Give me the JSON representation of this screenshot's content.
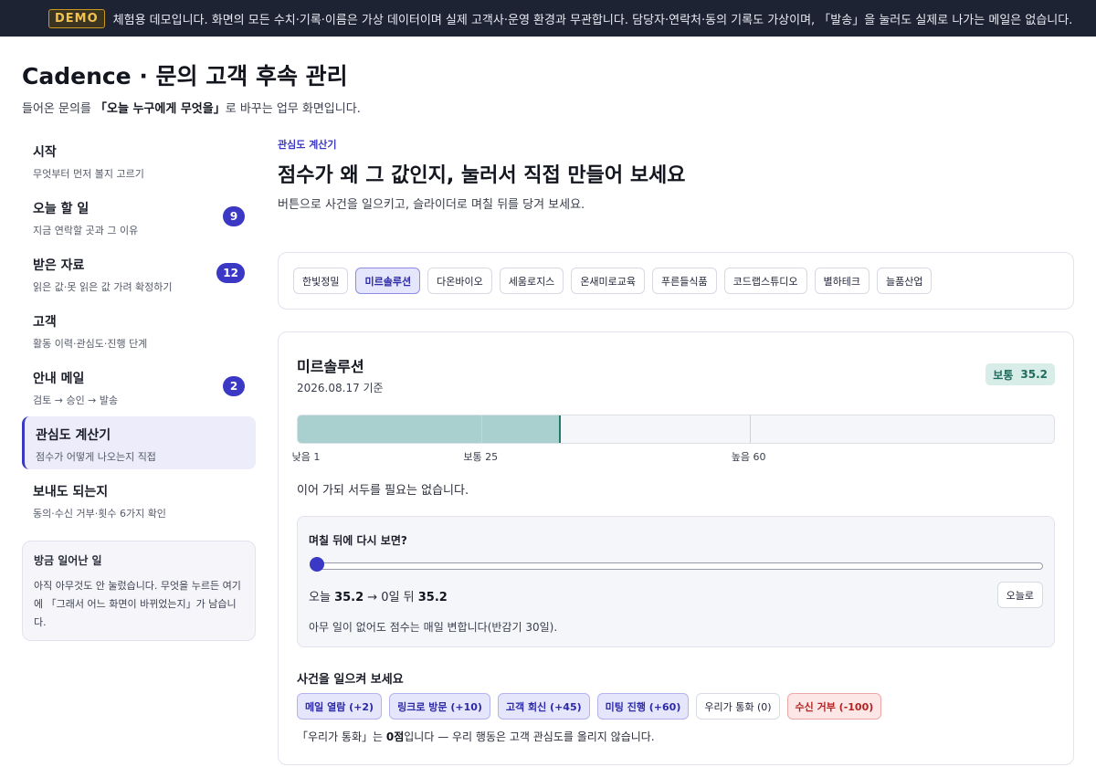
{
  "banner": {
    "badge": "DEMO",
    "text": "체험용 데모입니다. 화면의 모든 수치·기록·이름은 가상 데이터이며 실제 고객사·운영 환경과 무관합니다. 담당자·연락처·동의 기록도 가상이며, 「발송」을 눌러도 실제로 나가는 메일은 없습니다."
  },
  "header": {
    "title": "Cadence · 문의 고객 후속 관리",
    "subtitle_pre": "들어온 문의를 ",
    "subtitle_bold": "「오늘 누구에게 무엇을」",
    "subtitle_post": "로 바꾸는 업무 화면입니다."
  },
  "sidebar": {
    "items": [
      {
        "label": "시작",
        "desc": "무엇부터 먼저 볼지 고르기",
        "badge": ""
      },
      {
        "label": "오늘 할 일",
        "desc": "지금 연락할 곳과 그 이유",
        "badge": "9"
      },
      {
        "label": "받은 자료",
        "desc": "읽은 값·못 읽은 값 가려 확정하기",
        "badge": "12"
      },
      {
        "label": "고객",
        "desc": "활동 이력·관심도·진행 단계",
        "badge": ""
      },
      {
        "label": "안내 메일",
        "desc": "검토 → 승인 → 발송",
        "badge": "2"
      },
      {
        "label": "관심도 계산기",
        "desc": "점수가 어떻게 나오는지 직접",
        "badge": ""
      },
      {
        "label": "보내도 되는지",
        "desc": "동의·수신 거부·횟수 6가지 확인",
        "badge": ""
      }
    ],
    "recent": {
      "title": "방금 일어난 일",
      "body": "아직 아무것도 안 눌렀습니다. 무엇을 누르든 여기에 「그래서 어느 화면이 바뀌었는지」가 남습니다."
    }
  },
  "main": {
    "eyebrow": "관심도 계산기",
    "title": "점수가 왜 그 값인지, 눌러서 직접 만들어 보세요",
    "subtitle": "버튼으로 사건을 일으키고, 슬라이더로 며칠 뒤를 당겨 보세요.",
    "companies": [
      "한빛정밀",
      "미르솔루션",
      "다온바이오",
      "세움로지스",
      "온새미로교육",
      "푸른들식품",
      "코드랩스튜디오",
      "별하테크",
      "늘품산업"
    ],
    "selected_company": "미르솔루션",
    "detail": {
      "name": "미르솔루션",
      "date": "2026.08.17 기준",
      "level_label": "보통",
      "score": "35.2",
      "gauge": {
        "min": 1,
        "max": 100,
        "value": 35.2,
        "thresholds": [
          {
            "label": "낮음 1",
            "value": 1
          },
          {
            "label": "보통 25",
            "value": 25
          },
          {
            "label": "높음 60",
            "value": 60
          }
        ]
      },
      "message": "이어 가되 서두를 필요는 없습니다.",
      "forecast": {
        "title": "며칠 뒤에 다시 보면?",
        "days": 0,
        "days_max": 90,
        "today_label": "오늘 ",
        "today_score": "35.2",
        "arrow_text": " → 0일 뒤 ",
        "future_score": "35.2",
        "reset_label": "오늘로",
        "note": "아무 일이 없어도 점수는 매일 변합니다(반감기 30일)."
      },
      "events": {
        "title": "사건을 일으켜 보세요",
        "buttons": [
          {
            "label": "메일 열람 (+2)",
            "kind": "pos"
          },
          {
            "label": "링크로 방문 (+10)",
            "kind": "pos"
          },
          {
            "label": "고객 회신 (+45)",
            "kind": "pos"
          },
          {
            "label": "미팅 진행 (+60)",
            "kind": "pos"
          },
          {
            "label": "우리가 통화 (0)",
            "kind": "neutral"
          },
          {
            "label": "수신 거부 (-100)",
            "kind": "neg"
          }
        ],
        "note_pre": "「우리가 통화」는 ",
        "note_bold": "0점",
        "note_post": "입니다 — 우리 행동은 고객 관심도를 올리지 않습니다."
      }
    }
  }
}
